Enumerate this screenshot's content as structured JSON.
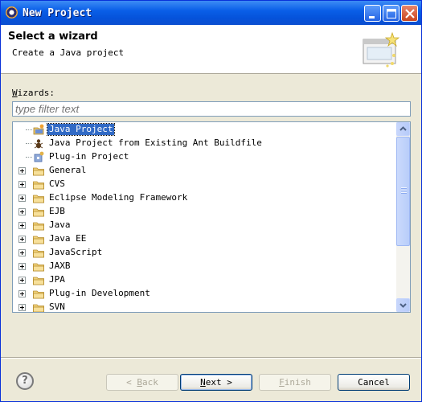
{
  "window": {
    "title": "New Project"
  },
  "header": {
    "title": "Select a wizard",
    "description": "Create a Java project"
  },
  "wizards": {
    "label_mnemonic": "W",
    "label_rest": "izards:",
    "filter_placeholder": "type filter text"
  },
  "tree": {
    "items": [
      {
        "label": "Java Project",
        "type": "leaf",
        "icon": "java-project-icon",
        "selected": true
      },
      {
        "label": "Java Project from Existing Ant Buildfile",
        "type": "leaf",
        "icon": "ant-project-icon"
      },
      {
        "label": "Plug-in Project",
        "type": "leaf",
        "icon": "plugin-project-icon"
      },
      {
        "label": "General",
        "type": "folder",
        "icon": "folder-icon"
      },
      {
        "label": "CVS",
        "type": "folder",
        "icon": "folder-icon"
      },
      {
        "label": "Eclipse Modeling Framework",
        "type": "folder",
        "icon": "folder-icon"
      },
      {
        "label": "EJB",
        "type": "folder",
        "icon": "folder-icon"
      },
      {
        "label": "Java",
        "type": "folder",
        "icon": "folder-icon"
      },
      {
        "label": "Java EE",
        "type": "folder",
        "icon": "folder-icon"
      },
      {
        "label": "JavaScript",
        "type": "folder",
        "icon": "folder-icon"
      },
      {
        "label": "JAXB",
        "type": "folder",
        "icon": "folder-icon"
      },
      {
        "label": "JPA",
        "type": "folder",
        "icon": "folder-icon"
      },
      {
        "label": "Plug-in Development",
        "type": "folder",
        "icon": "folder-icon"
      },
      {
        "label": "SVN",
        "type": "folder",
        "icon": "folder-icon"
      }
    ]
  },
  "buttons": {
    "back": {
      "prefix": "< ",
      "mnemonic": "B",
      "rest": "ack",
      "enabled": false
    },
    "next": {
      "mnemonic": "N",
      "rest": "ext >",
      "enabled": true
    },
    "finish": {
      "mnemonic": "F",
      "rest": "inish",
      "enabled": false
    },
    "cancel": {
      "label": "Cancel",
      "enabled": true
    }
  },
  "help": {
    "glyph": "?"
  },
  "colors": {
    "selection": "#316ac5",
    "titlebar": "#0a5fe8"
  }
}
